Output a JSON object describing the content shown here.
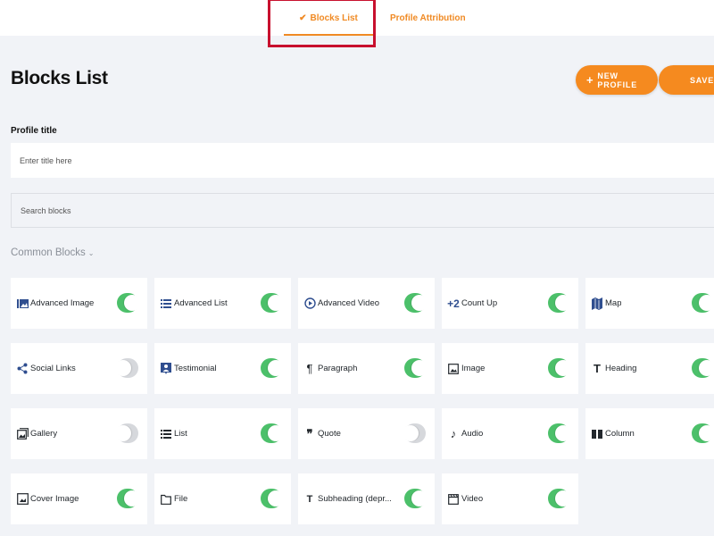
{
  "tabs": [
    {
      "label": "Blocks List",
      "active": true,
      "check": "✔"
    },
    {
      "label": "Profile Attribution",
      "active": false
    }
  ],
  "page_title": "Blocks List",
  "buttons": {
    "new_profile": "NEW PROFILE",
    "save": "SAVE"
  },
  "profile_title": {
    "label": "Profile title",
    "placeholder": "Enter title here"
  },
  "search": {
    "placeholder": "Search blocks"
  },
  "section_title": "Common Blocks",
  "colors": {
    "accent": "#f58a1f",
    "toggle_on": "#4cc06a",
    "toggle_off": "#d6d8dc",
    "icon": "#2f4e8f",
    "highlight": "#c8102e"
  },
  "blocks": [
    {
      "label": "Advanced Image",
      "icon": "advanced-image-icon",
      "enabled": true
    },
    {
      "label": "Advanced List",
      "icon": "advanced-list-icon",
      "enabled": true
    },
    {
      "label": "Advanced Video",
      "icon": "advanced-video-icon",
      "enabled": true
    },
    {
      "label": "Count Up",
      "icon": "count-up-icon",
      "enabled": true
    },
    {
      "label": "Map",
      "icon": "map-icon",
      "enabled": true
    },
    {
      "label": "Social Links",
      "icon": "share-icon",
      "enabled": false
    },
    {
      "label": "Testimonial",
      "icon": "testimonial-icon",
      "enabled": true
    },
    {
      "label": "Paragraph",
      "icon": "paragraph-icon",
      "enabled": true
    },
    {
      "label": "Image",
      "icon": "image-icon",
      "enabled": true
    },
    {
      "label": "Heading",
      "icon": "heading-icon",
      "enabled": true
    },
    {
      "label": "Gallery",
      "icon": "gallery-icon",
      "enabled": false
    },
    {
      "label": "List",
      "icon": "list-icon",
      "enabled": true
    },
    {
      "label": "Quote",
      "icon": "quote-icon",
      "enabled": false
    },
    {
      "label": "Audio",
      "icon": "audio-icon",
      "enabled": true
    },
    {
      "label": "Column",
      "icon": "column-icon",
      "enabled": true
    },
    {
      "label": "Cover Image",
      "icon": "cover-image-icon",
      "enabled": true
    },
    {
      "label": "File",
      "icon": "file-icon",
      "enabled": true
    },
    {
      "label": "Subheading (depr...",
      "icon": "subheading-icon",
      "enabled": true
    },
    {
      "label": "Video",
      "icon": "video-icon",
      "enabled": true
    }
  ]
}
